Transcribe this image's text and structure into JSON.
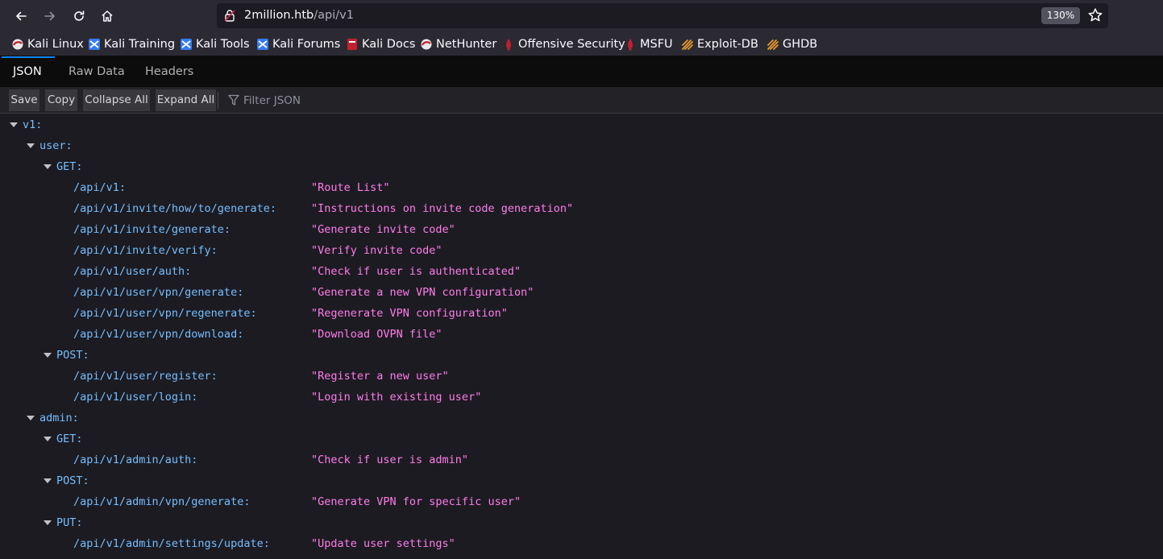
{
  "browser": {
    "url_host": "2million.htb",
    "url_path": "/api/v1",
    "zoom": "130%"
  },
  "bookmarks": [
    {
      "label": "Kali Linux",
      "icon": "kali-dragon-icon"
    },
    {
      "label": "Kali Training",
      "icon": "kali-training-icon"
    },
    {
      "label": "Kali Tools",
      "icon": "kali-tools-icon"
    },
    {
      "label": "Kali Forums",
      "icon": "kali-forums-icon"
    },
    {
      "label": "Kali Docs",
      "icon": "kali-docs-icon"
    },
    {
      "label": "NetHunter",
      "icon": "nethunter-icon"
    },
    {
      "label": "Offensive Security",
      "icon": "offsec-icon"
    },
    {
      "label": "MSFU",
      "icon": "msfu-icon"
    },
    {
      "label": "Exploit-DB",
      "icon": "exploitdb-icon"
    },
    {
      "label": "GHDB",
      "icon": "ghdb-icon"
    }
  ],
  "viewer_tabs": [
    "JSON",
    "Raw Data",
    "Headers"
  ],
  "toolbar": {
    "save": "Save",
    "copy": "Copy",
    "collapse_all": "Collapse All",
    "expand_all": "Expand All",
    "filter_placeholder": "Filter JSON"
  },
  "json_tree": {
    "root_key": "v1:",
    "user": {
      "key": "user:",
      "get_key": "GET:",
      "get": [
        {
          "path": "/api/v1:",
          "desc": "\"Route List\""
        },
        {
          "path": "/api/v1/invite/how/to/generate:",
          "desc": "\"Instructions on invite code generation\""
        },
        {
          "path": "/api/v1/invite/generate:",
          "desc": "\"Generate invite code\""
        },
        {
          "path": "/api/v1/invite/verify:",
          "desc": "\"Verify invite code\""
        },
        {
          "path": "/api/v1/user/auth:",
          "desc": "\"Check if user is authenticated\""
        },
        {
          "path": "/api/v1/user/vpn/generate:",
          "desc": "\"Generate a new VPN configuration\""
        },
        {
          "path": "/api/v1/user/vpn/regenerate:",
          "desc": "\"Regenerate VPN configuration\""
        },
        {
          "path": "/api/v1/user/vpn/download:",
          "desc": "\"Download OVPN file\""
        }
      ],
      "post_key": "POST:",
      "post": [
        {
          "path": "/api/v1/user/register:",
          "desc": "\"Register a new user\""
        },
        {
          "path": "/api/v1/user/login:",
          "desc": "\"Login with existing user\""
        }
      ]
    },
    "admin": {
      "key": "admin:",
      "get_key": "GET:",
      "get": [
        {
          "path": "/api/v1/admin/auth:",
          "desc": "\"Check if user is admin\""
        }
      ],
      "post_key": "POST:",
      "post": [
        {
          "path": "/api/v1/admin/vpn/generate:",
          "desc": "\"Generate VPN for specific user\""
        }
      ],
      "put_key": "PUT:",
      "put": [
        {
          "path": "/api/v1/admin/settings/update:",
          "desc": "\"Update user settings\""
        }
      ]
    }
  }
}
